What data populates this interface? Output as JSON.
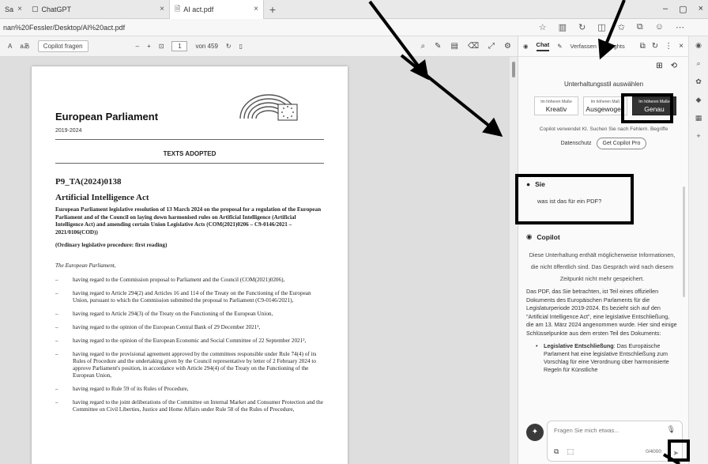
{
  "browser": {
    "tabs": [
      {
        "label": "Sa",
        "close": "×"
      },
      {
        "label": "ChatGPT",
        "close": "×"
      },
      {
        "label": "AI act.pdf",
        "close": "×"
      }
    ],
    "new_tab": "+",
    "window_controls": [
      "–",
      "▢",
      "×"
    ],
    "url": "nan%20Fessler/Desktop/AI%20act.pdf"
  },
  "pdf_toolbar": {
    "text_size": "A",
    "read_aloud": "aあ",
    "copilot_button": "Copilot fragen",
    "zoom_out": "–",
    "zoom_in": "+",
    "fit": "⊡",
    "page_current": "1",
    "page_total": "von 459",
    "rotate": "↻",
    "page_view": "▯"
  },
  "pdf": {
    "institution": "European Parliament",
    "years": "2019-2024",
    "section": "TEXTS ADOPTED",
    "doc_number": "P9_TA(2024)0138",
    "act_title": "Artificial Intelligence Act",
    "resolution": "European Parliament legislative resolution of 13 March 2024 on the proposal for a regulation of the European Parliament and of the Council on laying down harmonised rules on Artificial Intelligence (Artificial Intelligence Act) and amending certain Union Legislative Acts (COM(2021)0206 – C9-0146/2021 – 2021/0106(COD))",
    "procedure": "(Ordinary legislative procedure: first reading)",
    "parliament": "The European Parliament,",
    "recitals": [
      "having regard to the Commission proposal to Parliament and the Council (COM(2021)0206),",
      "having regard to Article 294(2) and Articles 16 and 114 of the Treaty on the Functioning of the European Union, pursuant to which the Commission submitted the proposal to Parliament (C9-0146/2021),",
      "having regard to Article 294(3) of the Treaty on the Functioning of the European Union,",
      "having regard to the opinion of the European Central Bank of 29 December 2021¹,",
      "having regard to the opinion of the European Economic and Social Committee of 22 September 2021²,",
      "having regard to the provisional agreement approved by the committees responsible under Rule 74(4) of its Rules of Procedure and the undertaking given by the Council representative by letter of 2 February 2024 to approve Parliament's position, in accordance with Article 294(4) of the Treaty on the Functioning of the European Union,",
      "having regard to Rule 59 of its Rules of Procedure,",
      "having regard to the joint deliberations of the Committee on Internal Market and Consumer Protection and the Committee on Civil Liberties, Justice and Home Affairs under Rule 58 of the Rules of Procedure,"
    ]
  },
  "sidebar": {
    "tabs": {
      "chat": "Chat",
      "compose": "Verfassen",
      "insights": "Insights"
    },
    "style_heading": "Unterhaltungsstil auswählen",
    "styles": [
      {
        "pre": "Im höheren Maße",
        "name": "Kreativ",
        "selected": false
      },
      {
        "pre": "Im höheren Maß",
        "name": "Ausgewogen",
        "selected": false
      },
      {
        "pre": "Im höheren Maße",
        "name": "Genau",
        "selected": true
      }
    ],
    "disclaimer": "Copilot verwendet KI. Suchen Sie nach Fehlern. Begriffe",
    "privacy": "Datenschutz",
    "get_pro": "Get Copilot Pro",
    "user_name": "Sie",
    "user_message": "was ist das für ein PDF?",
    "copilot_name": "Copilot",
    "copilot_note": "Diese Unterhaltung enthält möglicherweise Informationen, die nicht öffentlich sind. Das Gespräch wird nach diesem Zeitpunkt nicht mehr gespeichert.",
    "copilot_answer": "Das PDF, das Sie betrachten, ist Teil eines offiziellen Dokuments des Europäischen Parlaments für die Legislaturperiode 2019-2024. Es bezieht sich auf den \"Artificial Intelligence Act\", eine legislative Entschließung, die am 13. März 2024 angenommen wurde. Hier sind einige Schlüsselpunkte aus dem ersten Teil des Dokuments:",
    "bullet_label": "Legislative Entschließung",
    "bullet_text": ": Das Europäische Parlament hat eine legislative Entschließung zum Vorschlag für eine Verordnung über harmonisierte Regeln für Künstliche",
    "input_placeholder": "Fragen Sie mich etwas...",
    "counter": "0/4000",
    "send": "➤"
  }
}
